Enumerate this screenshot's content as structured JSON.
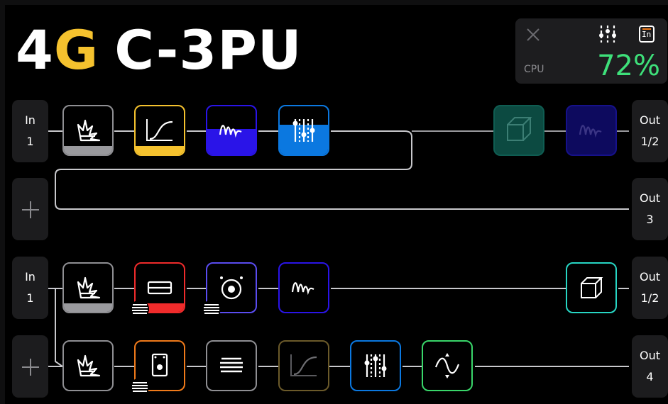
{
  "header": {
    "title_a": "4",
    "title_b": "G",
    "title_c": "C-3PU"
  },
  "cpu_meter": {
    "label": "CPU",
    "value": "72%",
    "value_color": "#3ee07a",
    "icons": [
      "close-icon",
      "mixer-icon",
      "input-icon"
    ],
    "input_icon_text": "In"
  },
  "rows": [
    {
      "input": {
        "label": "In",
        "number": "1"
      },
      "output": {
        "label": "Out",
        "number": "1/2"
      },
      "blocks": [
        "amp-icon",
        "eq-icon",
        "wave-icon",
        "mixer-icon",
        "cab-icon",
        "wave-icon"
      ]
    },
    {
      "input": {
        "label": "+"
      },
      "output": {
        "label": "Out",
        "number": "3"
      },
      "blocks": []
    },
    {
      "input": {
        "label": "In",
        "number": "1"
      },
      "output": {
        "label": "Out",
        "number": "1/2"
      },
      "blocks": [
        "amp-icon",
        "fader-icon",
        "speaker-icon",
        "wave-icon",
        "cube-icon"
      ]
    },
    {
      "input": {
        "label": "+"
      },
      "output": {
        "label": "Out",
        "number": "4"
      },
      "blocks": [
        "amp-icon",
        "pedal-icon",
        "stripe-icon",
        "eq-icon",
        "mixer-icon",
        "sine-icon"
      ]
    }
  ],
  "colors": {
    "yellow": "#f5c22e",
    "blue": "#2a14e8",
    "sky": "#0b78e0",
    "red": "#f02b2b",
    "violet": "#5a4cf0",
    "teal": "#27d6c4",
    "orange": "#f07a1a",
    "green": "#39d66a",
    "dark_teal": "#0f5d52"
  }
}
